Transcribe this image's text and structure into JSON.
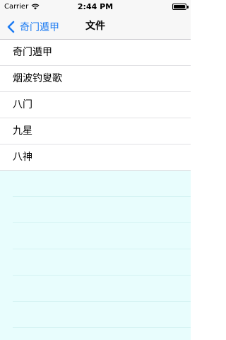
{
  "status_bar": {
    "carrier": "Carrier",
    "time": "2:44 PM",
    "battery_level": 1.0
  },
  "nav": {
    "back_label": "奇门遁甲",
    "title": "文件",
    "accent_color": "#1e7cf2"
  },
  "list": {
    "items": [
      {
        "label": "奇门遁甲"
      },
      {
        "label": "烟波钓叟歌"
      },
      {
        "label": "八门"
      },
      {
        "label": "九星"
      },
      {
        "label": "八神"
      }
    ]
  },
  "empty_area": {
    "background": "#e8fdfd"
  }
}
